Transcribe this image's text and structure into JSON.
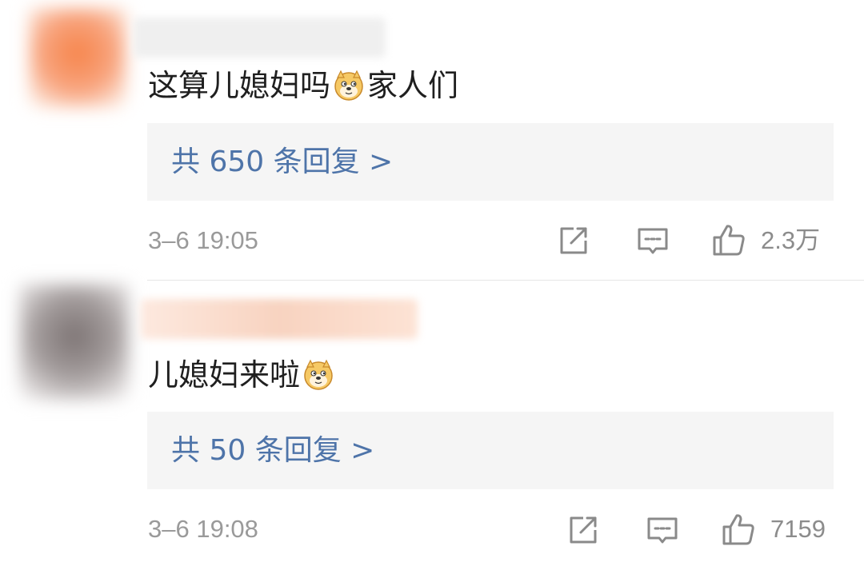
{
  "comments": [
    {
      "text_before": "这算儿媳妇吗",
      "emoji": "doge-emoji",
      "text_after": "家人们",
      "replies_label": "共 650 条回复 >",
      "time": "3–6 19:05",
      "likes": "2.3万",
      "avatar_color": "#f58a55",
      "name_color": "#ececec"
    },
    {
      "text_before": "儿媳妇来啦",
      "emoji": "doge-emoji",
      "text_after": "",
      "replies_label": "共 50 条回复 >",
      "time": "3–6 19:08",
      "likes": "7159",
      "avatar_color": "#8f8787",
      "name_color": "#f8dccd"
    }
  ],
  "icons": {
    "share": "share-icon",
    "comment": "comment-icon",
    "like": "thumbs-up-icon"
  },
  "colors": {
    "link_blue": "#4e74a9",
    "meta_gray": "#9a9a9a",
    "reply_bg": "#f5f5f5"
  }
}
